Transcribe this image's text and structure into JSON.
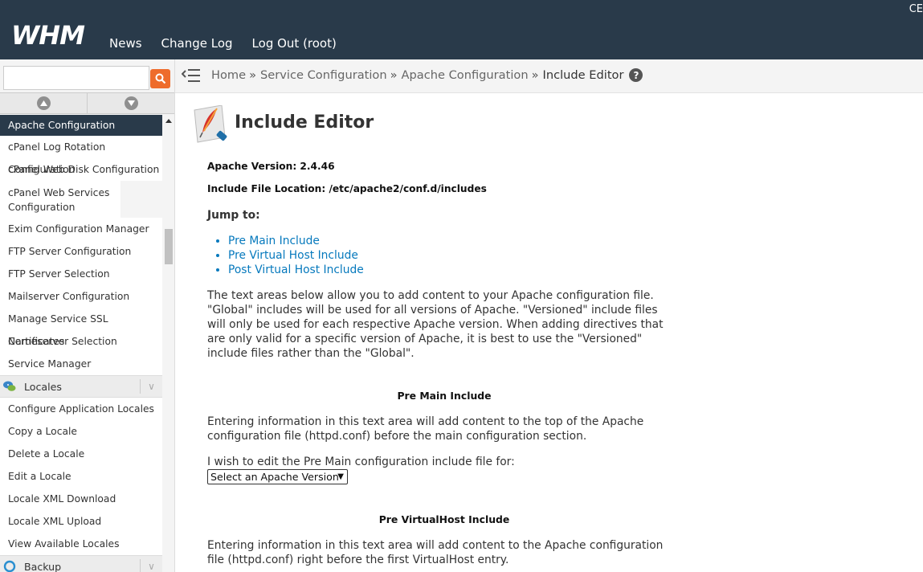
{
  "header": {
    "logo_text": "WHM",
    "nav": [
      "News",
      "Change Log",
      "Log Out (root)"
    ],
    "corner_text": "CE"
  },
  "sidebar": {
    "search": {
      "placeholder": "",
      "value": ""
    },
    "items_top": [
      {
        "label": "Apache Configuration",
        "active": true
      },
      {
        "label": "cPanel Log Rotation Configuration"
      },
      {
        "label": "cPanel Web Disk Configuration"
      },
      {
        "label": "cPanel Web Services Configuration"
      },
      {
        "label": "Exim Configuration Manager"
      },
      {
        "label": "FTP Server Configuration"
      },
      {
        "label": "FTP Server Selection"
      },
      {
        "label": "Mailserver Configuration"
      },
      {
        "label": "Manage Service SSL Certificates"
      },
      {
        "label": "Nameserver Selection"
      },
      {
        "label": "Service Manager"
      }
    ],
    "category_locales": "Locales",
    "items_locales": [
      {
        "label": "Configure Application Locales"
      },
      {
        "label": "Copy a Locale"
      },
      {
        "label": "Delete a Locale"
      },
      {
        "label": "Edit a Locale"
      },
      {
        "label": "Locale XML Download"
      },
      {
        "label": "Locale XML Upload"
      },
      {
        "label": "View Available Locales"
      }
    ],
    "category_backup": "Backup"
  },
  "breadcrumb": {
    "items": [
      "Home",
      "Service Configuration",
      "Apache Configuration"
    ],
    "separator": "»",
    "current": "Include Editor",
    "help": "?"
  },
  "main": {
    "title": "Include Editor",
    "apache_version": "Apache Version: 2.4.46",
    "include_location": "Include File Location: /etc/apache2/conf.d/includes",
    "jump_label": "Jump to:",
    "jump_links": [
      "Pre Main Include",
      "Pre Virtual Host Include",
      "Post Virtual Host Include"
    ],
    "intro": "The text areas below allow you to add content to your Apache configuration file. \"Global\" includes will be used for all versions of Apache. \"Versioned\" include files will only be used for each respective Apache version. When adding directives that are only valid for a specific version of Apache, it is best to use the \"Versioned\" include files rather than the \"Global\".",
    "section1_title": "Pre Main Include",
    "section1_desc": "Entering information in this text area will add content to the top of the Apache configuration file (httpd.conf) before the main configuration section.",
    "section1_edit_label": "I wish to edit the Pre Main configuration include file for:",
    "section1_select": "Select an Apache Version",
    "section2_title": "Pre VirtualHost Include",
    "section2_desc": "Entering information in this text area will add content to the Apache configuration file (httpd.conf) right before the first VirtualHost entry."
  },
  "colors": {
    "topbar": "#293a4a",
    "search_button": "#ee6c2c",
    "link": "#0679bd",
    "active_item": "#293a4a"
  }
}
